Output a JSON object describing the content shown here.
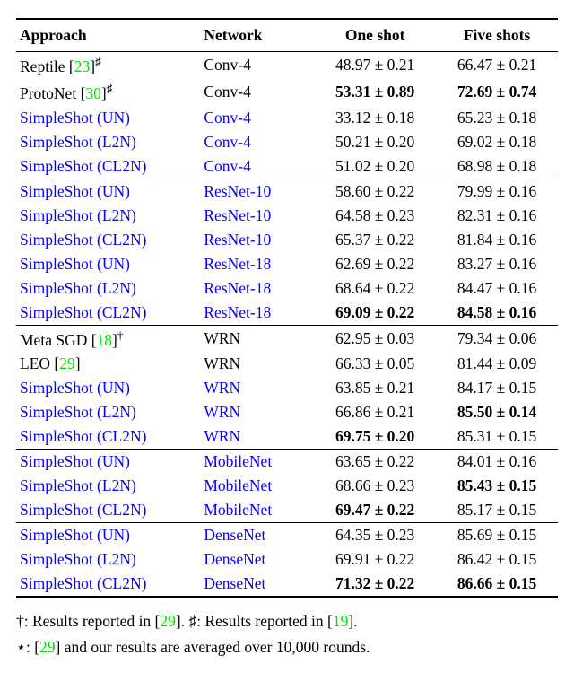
{
  "headers": {
    "c1": "Approach",
    "c2": "Network",
    "c3": "One shot",
    "c4": "Five shots"
  },
  "rows": [
    {
      "approach": {
        "text": "Reptile ",
        "cite": "23",
        "suffix": "]",
        "mark": "♯",
        "blue": false
      },
      "network": {
        "text": "Conv-4",
        "blue": false
      },
      "one": {
        "val": "48.97 ± 0.21",
        "bold": false
      },
      "five": {
        "val": "66.47 ± 0.21",
        "bold": false
      },
      "sep": false
    },
    {
      "approach": {
        "text": "ProtoNet ",
        "cite": "30",
        "suffix": "]",
        "mark": "♯",
        "blue": false
      },
      "network": {
        "text": "Conv-4",
        "blue": false
      },
      "one": {
        "val": "53.31 ± 0.89",
        "bold": true
      },
      "five": {
        "val": "72.69 ± 0.74",
        "bold": true
      },
      "sep": false
    },
    {
      "approach": {
        "text": "SimpleShot (UN)",
        "blue": true
      },
      "network": {
        "text": "Conv-4",
        "blue": true
      },
      "one": {
        "val": "33.12 ± 0.18",
        "bold": false
      },
      "five": {
        "val": "65.23 ± 0.18",
        "bold": false
      },
      "sep": false
    },
    {
      "approach": {
        "text": "SimpleShot (L2N)",
        "blue": true
      },
      "network": {
        "text": "Conv-4",
        "blue": true
      },
      "one": {
        "val": "50.21 ± 0.20",
        "bold": false
      },
      "five": {
        "val": "69.02 ± 0.18",
        "bold": false
      },
      "sep": false
    },
    {
      "approach": {
        "text": "SimpleShot (CL2N)",
        "blue": true
      },
      "network": {
        "text": "Conv-4",
        "blue": true
      },
      "one": {
        "val": "51.02 ± 0.20",
        "bold": false
      },
      "five": {
        "val": "68.98 ± 0.18",
        "bold": false
      },
      "sep": false
    },
    {
      "approach": {
        "text": "SimpleShot (UN)",
        "blue": true
      },
      "network": {
        "text": "ResNet-10",
        "blue": true
      },
      "one": {
        "val": "58.60 ± 0.22",
        "bold": false
      },
      "five": {
        "val": "79.99 ± 0.16",
        "bold": false
      },
      "sep": true
    },
    {
      "approach": {
        "text": "SimpleShot (L2N)",
        "blue": true
      },
      "network": {
        "text": "ResNet-10",
        "blue": true
      },
      "one": {
        "val": "64.58 ± 0.23",
        "bold": false
      },
      "five": {
        "val": "82.31 ± 0.16",
        "bold": false
      },
      "sep": false
    },
    {
      "approach": {
        "text": "SimpleShot (CL2N)",
        "blue": true
      },
      "network": {
        "text": "ResNet-10",
        "blue": true
      },
      "one": {
        "val": "65.37 ± 0.22",
        "bold": false
      },
      "five": {
        "val": "81.84 ± 0.16",
        "bold": false
      },
      "sep": false
    },
    {
      "approach": {
        "text": "SimpleShot (UN)",
        "blue": true
      },
      "network": {
        "text": "ResNet-18",
        "blue": true
      },
      "one": {
        "val": "62.69 ± 0.22",
        "bold": false
      },
      "five": {
        "val": "83.27 ± 0.16",
        "bold": false
      },
      "sep": false
    },
    {
      "approach": {
        "text": "SimpleShot (L2N)",
        "blue": true
      },
      "network": {
        "text": "ResNet-18",
        "blue": true
      },
      "one": {
        "val": "68.64 ± 0.22",
        "bold": false
      },
      "five": {
        "val": "84.47 ± 0.16",
        "bold": false
      },
      "sep": false
    },
    {
      "approach": {
        "text": "SimpleShot (CL2N)",
        "blue": true
      },
      "network": {
        "text": "ResNet-18",
        "blue": true
      },
      "one": {
        "val": "69.09 ± 0.22",
        "bold": true
      },
      "five": {
        "val": "84.58 ± 0.16",
        "bold": true
      },
      "sep": false
    },
    {
      "approach": {
        "text": "Meta SGD ",
        "cite": "18",
        "suffix": "]",
        "mark": "†",
        "blue": false
      },
      "network": {
        "text": "WRN",
        "blue": false
      },
      "one": {
        "val": "62.95 ± 0.03",
        "bold": false
      },
      "five": {
        "val": "79.34 ± 0.06",
        "bold": false
      },
      "sep": true
    },
    {
      "approach": {
        "text": "LEO ",
        "cite": "29",
        "suffix": "]",
        "blue": false
      },
      "network": {
        "text": "WRN",
        "blue": false
      },
      "one": {
        "val": "66.33 ± 0.05",
        "bold": false
      },
      "five": {
        "val": "81.44 ± 0.09",
        "bold": false
      },
      "sep": false
    },
    {
      "approach": {
        "text": "SimpleShot (UN)",
        "blue": true
      },
      "network": {
        "text": "WRN",
        "blue": true
      },
      "one": {
        "val": "63.85 ± 0.21",
        "bold": false
      },
      "five": {
        "val": "84.17 ± 0.15",
        "bold": false
      },
      "sep": false
    },
    {
      "approach": {
        "text": "SimpleShot (L2N)",
        "blue": true
      },
      "network": {
        "text": "WRN",
        "blue": true
      },
      "one": {
        "val": "66.86 ± 0.21",
        "bold": false
      },
      "five": {
        "val": "85.50 ± 0.14",
        "bold": true
      },
      "sep": false
    },
    {
      "approach": {
        "text": "SimpleShot (CL2N)",
        "blue": true
      },
      "network": {
        "text": "WRN",
        "blue": true
      },
      "one": {
        "val": "69.75 ± 0.20",
        "bold": true
      },
      "five": {
        "val": "85.31 ± 0.15",
        "bold": false
      },
      "sep": false
    },
    {
      "approach": {
        "text": "SimpleShot (UN)",
        "blue": true
      },
      "network": {
        "text": "MobileNet",
        "blue": true
      },
      "one": {
        "val": "63.65 ± 0.22",
        "bold": false
      },
      "five": {
        "val": "84.01 ± 0.16",
        "bold": false
      },
      "sep": true
    },
    {
      "approach": {
        "text": "SimpleShot (L2N)",
        "blue": true
      },
      "network": {
        "text": "MobileNet",
        "blue": true
      },
      "one": {
        "val": "68.66 ± 0.23",
        "bold": false
      },
      "five": {
        "val": "85.43 ± 0.15",
        "bold": true
      },
      "sep": false
    },
    {
      "approach": {
        "text": "SimpleShot (CL2N)",
        "blue": true
      },
      "network": {
        "text": "MobileNet",
        "blue": true
      },
      "one": {
        "val": "69.47 ± 0.22",
        "bold": true
      },
      "five": {
        "val": "85.17 ± 0.15",
        "bold": false
      },
      "sep": false
    },
    {
      "approach": {
        "text": "SimpleShot (UN)",
        "blue": true
      },
      "network": {
        "text": "DenseNet",
        "blue": true
      },
      "one": {
        "val": "64.35 ± 0.23",
        "bold": false
      },
      "five": {
        "val": "85.69 ± 0.15",
        "bold": false
      },
      "sep": true
    },
    {
      "approach": {
        "text": "SimpleShot (L2N)",
        "blue": true
      },
      "network": {
        "text": "DenseNet",
        "blue": true
      },
      "one": {
        "val": "69.91 ± 0.22",
        "bold": false
      },
      "five": {
        "val": "86.42 ± 0.15",
        "bold": false
      },
      "sep": false
    },
    {
      "approach": {
        "text": "SimpleShot (CL2N)",
        "blue": true
      },
      "network": {
        "text": "DenseNet",
        "blue": true
      },
      "one": {
        "val": "71.32 ± 0.22",
        "bold": true
      },
      "five": {
        "val": "86.66 ± 0.15",
        "bold": true
      },
      "sep": false,
      "last": true
    }
  ],
  "notes": {
    "line1": {
      "pre": "†: Results reported in [",
      "cite1": "29",
      "mid": "].   ♯: Results reported in [",
      "cite2": "19",
      "post": "]."
    },
    "line2": {
      "pre": "⋆: [",
      "cite": "29",
      "post": "] and our results are averaged over 10,000 rounds."
    }
  }
}
